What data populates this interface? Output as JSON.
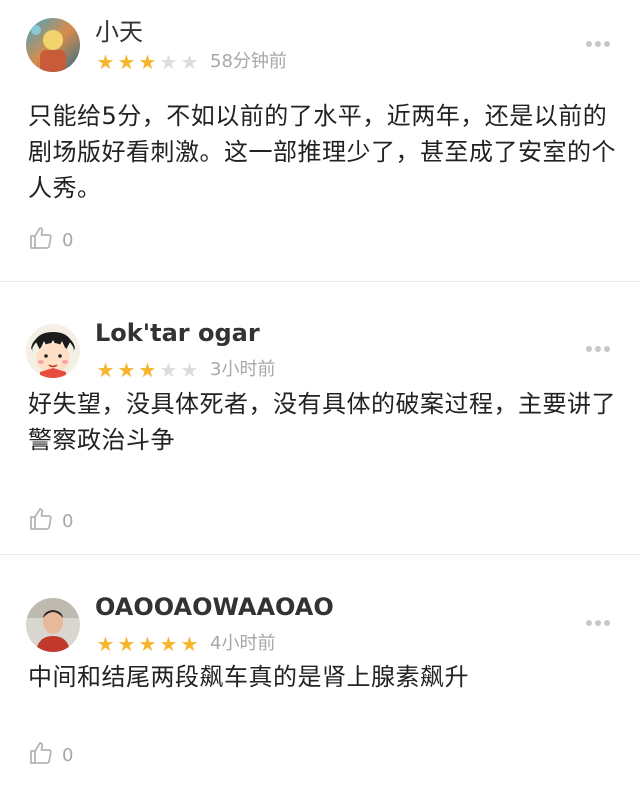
{
  "reviews": [
    {
      "username": "小天",
      "rating": 3,
      "max_rating": 5,
      "time": "58分钟前",
      "content": "只能给5分，不如以前的了水平，近两年，还是以前的剧场版好看刺激。这一部推理少了，甚至成了安室的个人秀。",
      "likes": "0"
    },
    {
      "username": "Lok'tar ogar",
      "rating": 3,
      "max_rating": 5,
      "time": "3小时前",
      "content": "好失望，没具体死者，没有具体的破案过程，主要讲了警察政治斗争",
      "likes": "0"
    },
    {
      "username": "OAOOAOWAAOAO",
      "rating": 5,
      "max_rating": 5,
      "time": "4小时前",
      "content": "中间和结尾两段飙车真的是肾上腺素飙升",
      "likes": "0"
    }
  ],
  "colors": {
    "star_on": "#f6b52a",
    "star_off": "#dcdcdc",
    "meta_text": "#a7a7a7",
    "divider": "#e9e9e9"
  },
  "icons": {
    "rating_star": "star-icon",
    "more_menu": "more-dots-icon",
    "like": "thumbs-up-icon"
  }
}
